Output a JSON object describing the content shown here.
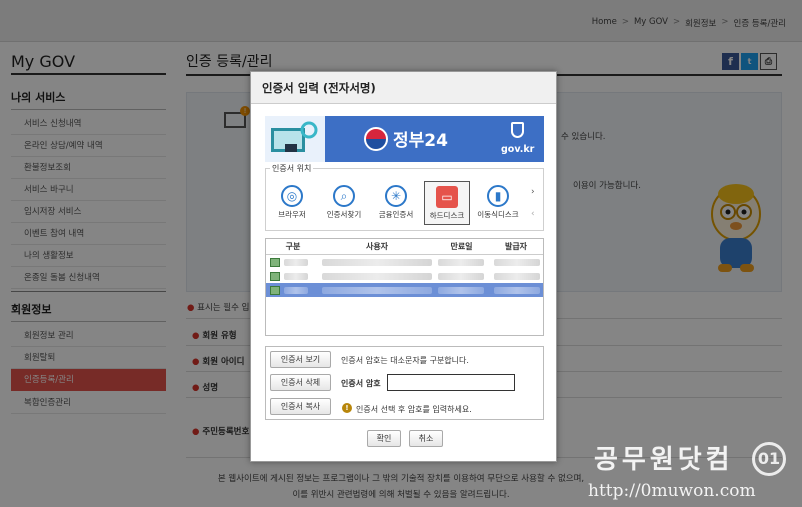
{
  "breadcrumb": [
    "Home",
    "My GOV",
    "회원정보",
    "인증 등록/관리"
  ],
  "leftnav": {
    "title": "My GOV",
    "sections": [
      {
        "title": "나의 서비스",
        "items": [
          "서비스 신청내역",
          "온라인 상담/예약 내역",
          "환불정보조회",
          "서비스 바구니",
          "임시저장 서비스",
          "이벤트 참여 내역",
          "나의 생활정보",
          "온종일 돌봄 신청내역"
        ]
      },
      {
        "title": "회원정보",
        "items": [
          "회원정보 관리",
          "회원탈퇴",
          "인증등록/관리",
          "복합인증관리"
        ]
      }
    ],
    "active_item": "인증등록/관리"
  },
  "main": {
    "title": "인증 등록/관리",
    "info_lines": [
      "수 있습니다.",
      "이용이 가능합니다."
    ],
    "required_note": "표시는 필수 입",
    "form_labels": [
      "회원 유형",
      "회원 아이디",
      "성명",
      "주민등록번호"
    ],
    "footer_lines": [
      "본 웹사이트에 게시된 정보는 프로그램이나 그 밖의 기술적 장치를 이용하여 무단으로 사용할 수 없으며,",
      "이를 위반시 관련법령에 의해 처벌될 수 있음을 알려드립니다."
    ]
  },
  "share": {
    "facebook": "f",
    "twitter": "t",
    "print": "⎙"
  },
  "dialog": {
    "title": "인증서 입력 (전자서명)",
    "banner": {
      "brand": "정부24",
      "domain": "gov.kr"
    },
    "location_legend": "인증서 위치",
    "locations": [
      {
        "label": "브라우저",
        "icon": "globe-icon",
        "glyph": "◎"
      },
      {
        "label": "인증서찾기",
        "icon": "search-icon",
        "glyph": "⌕"
      },
      {
        "label": "금융인증서",
        "icon": "asterisk-icon",
        "glyph": "✳"
      },
      {
        "label": "하드디스크",
        "icon": "harddisk-icon",
        "glyph": "▭"
      },
      {
        "label": "이동식디스크",
        "icon": "usb-icon",
        "glyph": "▮"
      }
    ],
    "selected_location": "하드디스크",
    "table_headers": [
      "구분",
      "사용자",
      "만료일",
      "발급자"
    ],
    "buttons": {
      "view": "인증서 보기",
      "delete": "인증서 삭제",
      "copy": "인증서 복사",
      "ok": "확인",
      "cancel": "취소"
    },
    "case_hint": "인증서 암호는 대소문자를 구분합니다.",
    "password_label": "인증서 암호",
    "password_value": "",
    "warning": "인증서 선택 후 암호를 입력하세요."
  },
  "watermark": {
    "text": "공무원닷컴",
    "url": "http://0muwon.com",
    "logo": "01"
  },
  "colors": {
    "active_nav": "#e5534b",
    "banner_blue": "#3d6fc5",
    "selected_row": "#6c8fd6"
  }
}
